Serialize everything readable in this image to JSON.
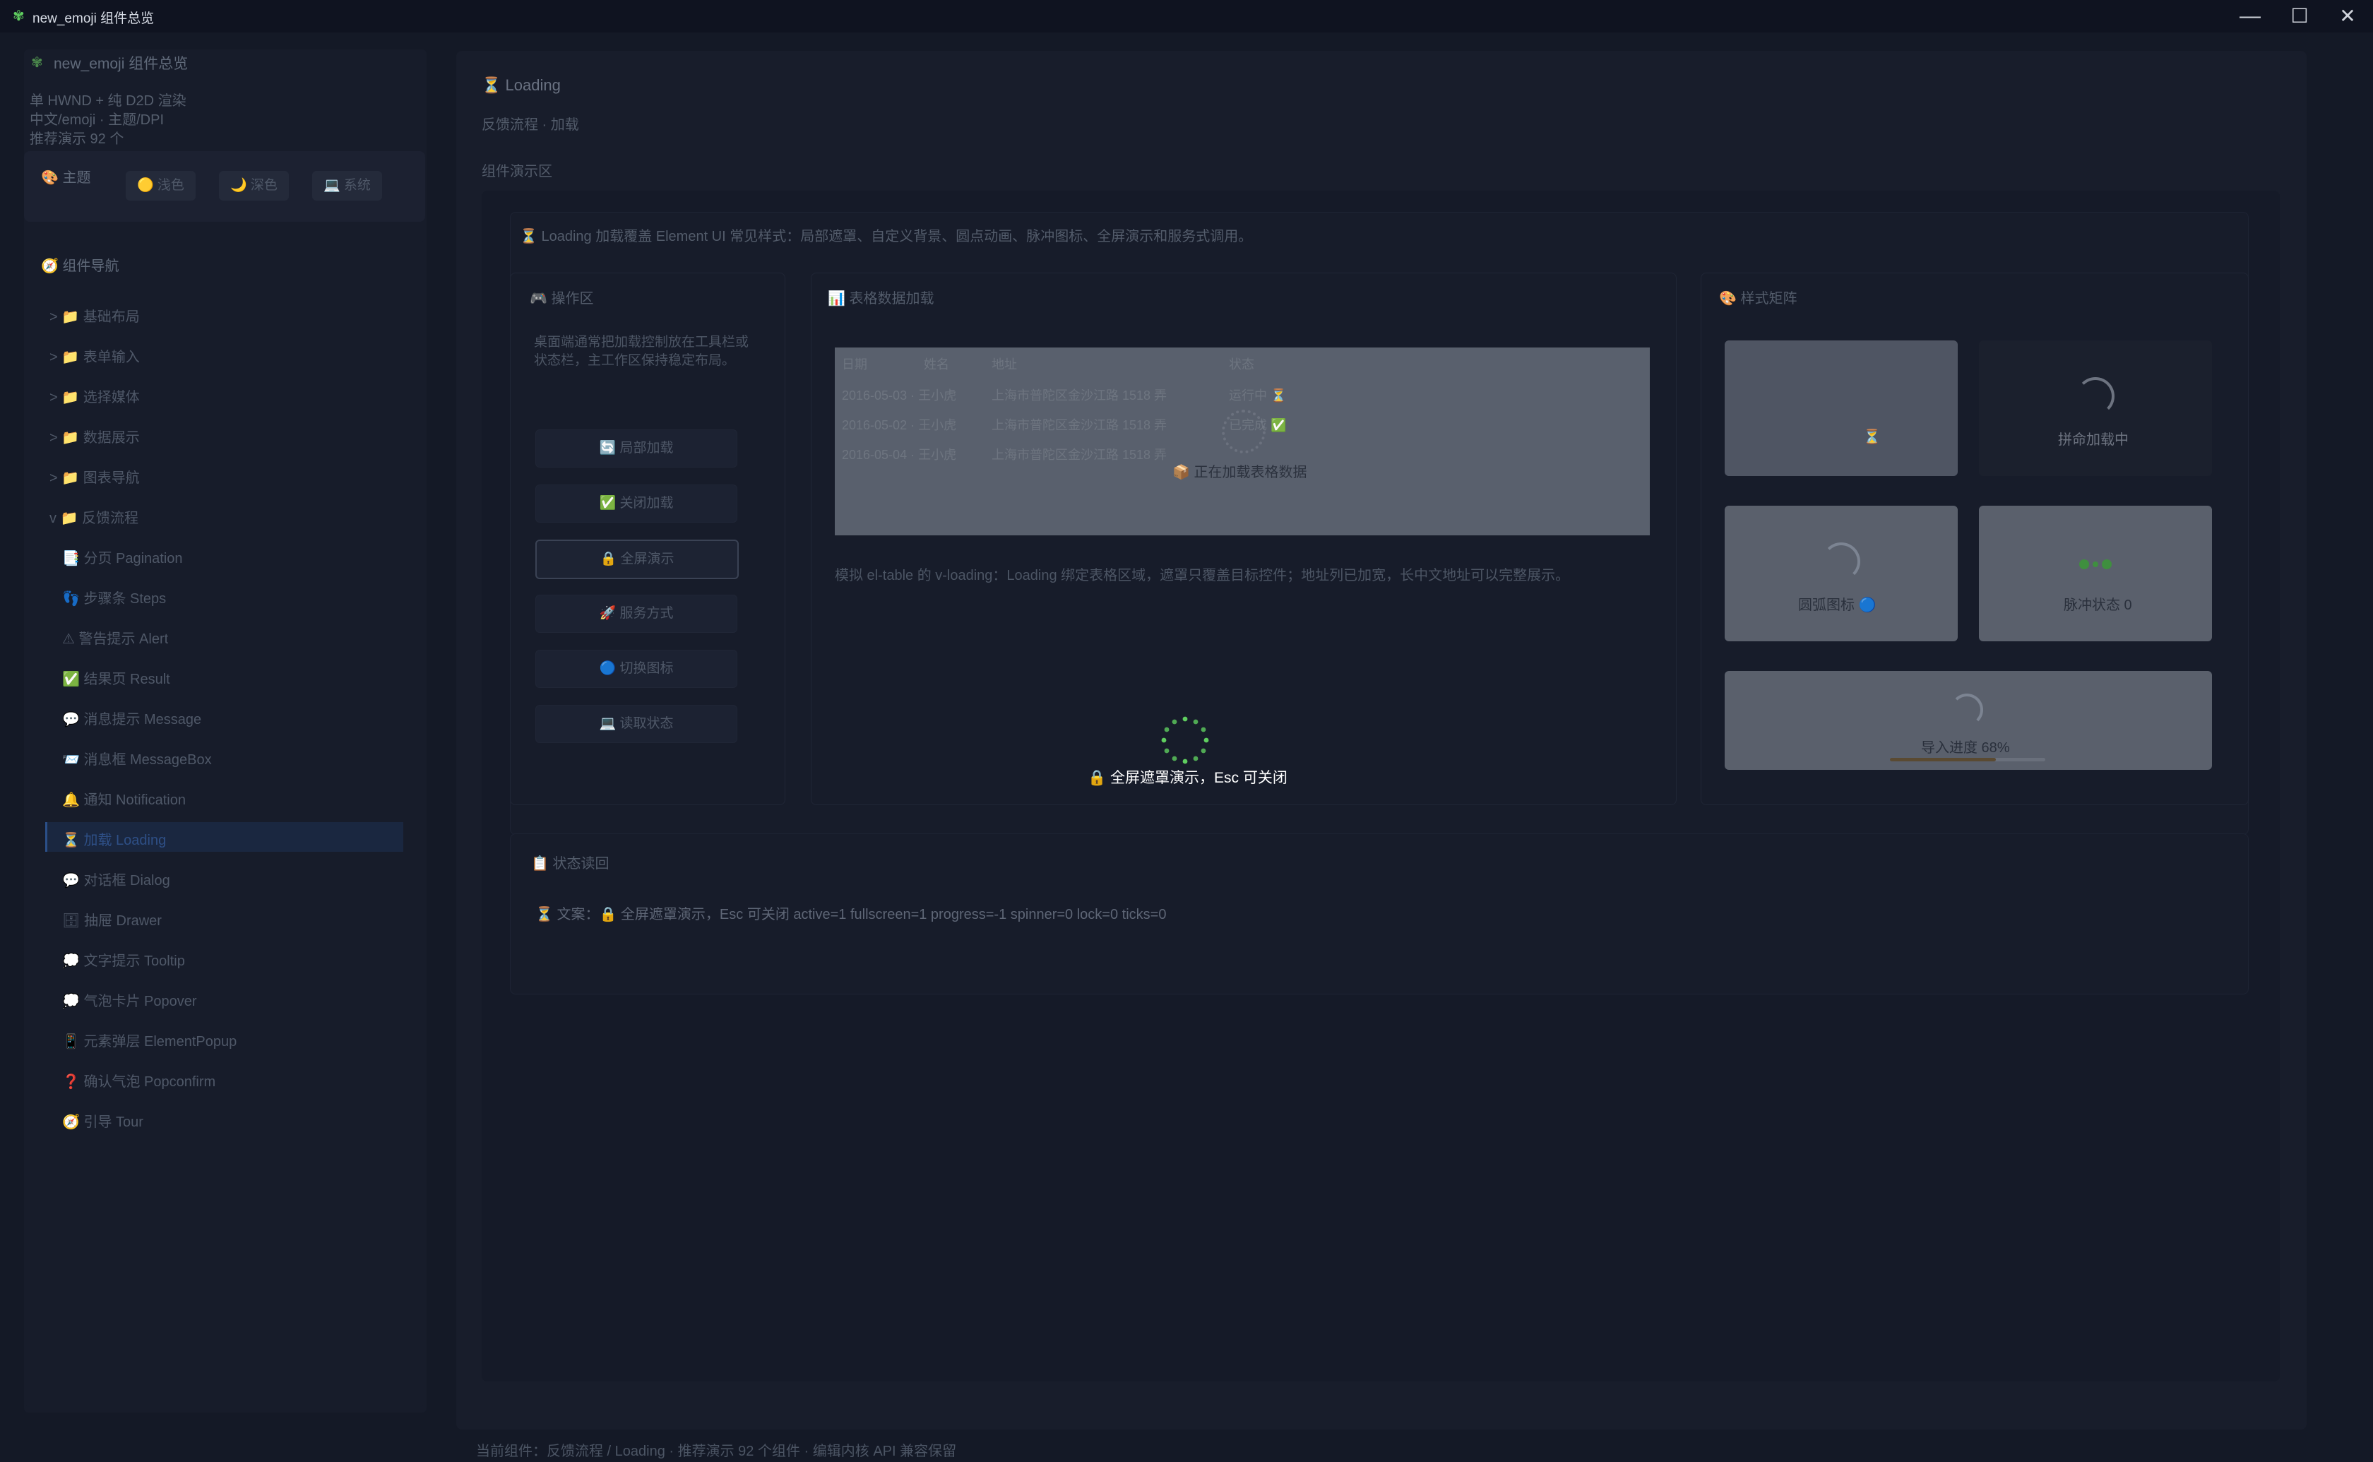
{
  "window": {
    "title": "new_emoji 组件总览",
    "logo_icon": "✾",
    "minimize": "—",
    "maximize": "☐",
    "close": "✕"
  },
  "sidebar": {
    "brand_icon": "✾",
    "brand": "new_emoji 组件总览",
    "info": [
      "单 HWND + 纯 D2D 渲染",
      "中文/emoji · 主题/DPI",
      "推荐演示 92 个"
    ],
    "theme": {
      "label": "🎨 主题",
      "options": [
        "🟡 浅色",
        "🌙 深色",
        "💻 系统"
      ]
    },
    "nav": {
      "header": "🧭 组件导航",
      "groups": [
        "> 📁 基础布局",
        "> 📁 表单输入",
        "> 📁 选择媒体",
        "> 📁 数据展示",
        "> 📁 图表导航",
        "v 📁 反馈流程"
      ],
      "items": [
        "📑 分页 Pagination",
        "👣 步骤条 Steps",
        "⚠ 警告提示 Alert",
        "✅ 结果页 Result",
        "💬 消息提示 Message",
        "📨 消息框 MessageBox",
        "🔔 通知 Notification",
        "⏳ 加载 Loading",
        "💬 对话框 Dialog",
        "🗄 抽屉 Drawer",
        "💭 文字提示 Tooltip",
        "💭 气泡卡片 Popover",
        "📱 元素弹层 ElementPopup",
        "❓ 确认气泡 Popconfirm",
        "🧭 引导 Tour"
      ]
    }
  },
  "main": {
    "title": "⏳ Loading",
    "crumb": "反馈流程 · 加载",
    "demo_label": "组件演示区",
    "intro": "⏳ Loading 加载覆盖 Element UI 常见样式：局部遮罩、自定义背景、圆点动画、脉冲图标、全屏演示和服务式调用。",
    "ops": {
      "title": "🎮 操作区",
      "desc": "桌面端通常把加载控制放在工具栏或状态栏，主工作区保持稳定布局。",
      "buttons": [
        "🔄 局部加载",
        "✅ 关闭加载",
        "🔒 全屏演示",
        "🚀 服务方式",
        "🔵 切换图标",
        "💻 读取状态"
      ]
    },
    "table": {
      "title": "📊 表格数据加载",
      "headers": [
        "日期",
        "姓名",
        "地址",
        "状态"
      ],
      "rows": [
        [
          "2016-05-03 · 王小虎",
          "上海市普陀区金沙江路 1518 弄",
          "运行中 ⏳"
        ],
        [
          "2016-05-02 · 王小虎",
          "上海市普陀区金沙江路 1518 弄",
          "已完成 ✅"
        ],
        [
          "2016-05-04 · 王小虎",
          "上海市普陀区金沙江路 1518 弄",
          ""
        ]
      ],
      "loading_text": "📦 正在加载表格数据",
      "note": "模拟 el-table 的 v-loading：Loading 绑定表格区域，遮罩只覆盖目标控件；地址列已加宽，长中文地址可以完整展示。"
    },
    "styles": {
      "title": "🎨 样式矩阵",
      "box1_label": "⏳",
      "box2_label": "拼命加载中",
      "box3_label": "圆弧图标 🔵",
      "box4_label": "脉冲状态 0",
      "box5_label": "导入进度 68%",
      "progress": 0.68
    },
    "fullscreen": {
      "text": "🔒 全屏遮罩演示，Esc 可关闭",
      "spinner_color": "#5fce5f"
    },
    "status": {
      "title": "📋 状态读回",
      "text": "⏳ 文案：🔒 全屏遮罩演示，Esc 可关闭  active=1  fullscreen=1  progress=-1  spinner=0  lock=0  ticks=0"
    }
  },
  "footer": "当前组件：反馈流程 / Loading · 推荐演示 92 个组件 · 编辑内核 API 兼容保留"
}
